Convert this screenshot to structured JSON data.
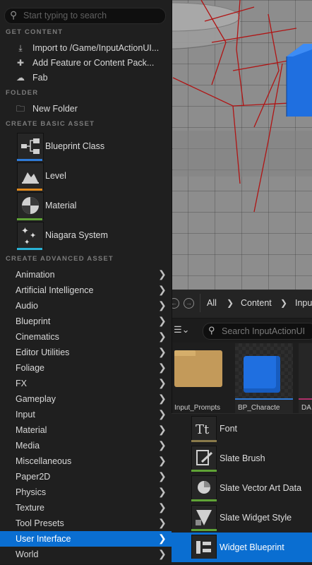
{
  "menu": {
    "search_placeholder": "Start typing to search",
    "sections": {
      "get_content": "GET CONTENT",
      "folder": "FOLDER",
      "create_basic": "CREATE BASIC ASSET",
      "create_advanced": "CREATE ADVANCED ASSET"
    },
    "get_content_items": [
      {
        "label": "Import to /Game/InputActionUI...",
        "icon": "import-icon"
      },
      {
        "label": "Add Feature or Content Pack...",
        "icon": "add-feature-icon"
      },
      {
        "label": "Fab",
        "icon": "fab-icon"
      }
    ],
    "folder_items": [
      {
        "label": "New Folder",
        "icon": "new-folder-icon"
      }
    ],
    "basic_assets": [
      {
        "label": "Blueprint Class",
        "icon": "blueprint-class-icon",
        "color": "#2f7bd8"
      },
      {
        "label": "Level",
        "icon": "level-icon",
        "color": "#e08a1e"
      },
      {
        "label": "Material",
        "icon": "material-icon",
        "color": "#5fa336"
      },
      {
        "label": "Niagara System",
        "icon": "niagara-system-icon",
        "color": "#2ab3d6"
      }
    ],
    "advanced_categories": [
      "Animation",
      "Artificial Intelligence",
      "Audio",
      "Blueprint",
      "Cinematics",
      "Editor Utilities",
      "Foliage",
      "FX",
      "Gameplay",
      "Input",
      "Material",
      "Media",
      "Miscellaneous",
      "Paper2D",
      "Physics",
      "Texture",
      "Tool Presets",
      "User Interface",
      "World"
    ],
    "selected_category": "User Interface"
  },
  "submenu": {
    "items": [
      {
        "label": "Font",
        "icon": "font-icon",
        "color": "#8a7a4a"
      },
      {
        "label": "Slate Brush",
        "icon": "slate-brush-icon",
        "color": "#5fa336"
      },
      {
        "label": "Slate Vector Art Data",
        "icon": "slate-vector-art-icon",
        "color": "#5fa336"
      },
      {
        "label": "Slate Widget Style",
        "icon": "slate-widget-style-icon",
        "color": "#5fa336"
      },
      {
        "label": "Widget Blueprint",
        "icon": "widget-blueprint-icon",
        "color": "#0a6ed1"
      }
    ],
    "selected": "Widget Blueprint"
  },
  "content_browser": {
    "breadcrumbs": [
      "All",
      "Content",
      "Inpu"
    ],
    "search_placeholder": "Search InputActionUI",
    "assets": [
      {
        "label": "Input_Prompts",
        "type": "folder"
      },
      {
        "label": "BP_Characte",
        "type": "blueprint"
      },
      {
        "label": "DA",
        "type": "data-asset"
      }
    ]
  },
  "colors": {
    "accent": "#0a6ed1",
    "menu_bg": "#1f1f1f",
    "viewport_grid": "#8d8d8d",
    "cube": "#1f6fe0",
    "debug_lines": "#b01414"
  }
}
